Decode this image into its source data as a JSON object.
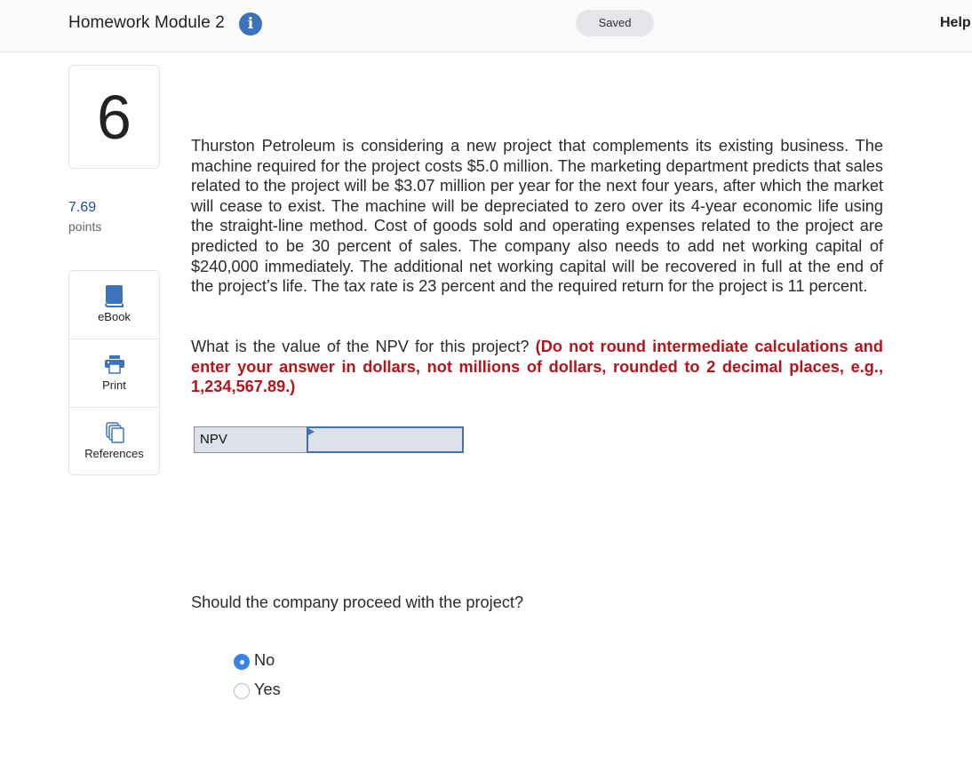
{
  "header": {
    "title": "Homework Module 2",
    "info_icon": "info-icon",
    "saved_label": "Saved",
    "help_label": "Help"
  },
  "question": {
    "number": "6",
    "points_value": "7.69",
    "points_label": "points",
    "body": "Thurston Petroleum is considering a new project that complements its existing business. The machine required for the project costs $5.0 million. The marketing department predicts that sales related to the project will be $3.07 million per year for the next four years, after which the market will cease to exist. The machine will be depreciated to zero over its 4-year economic life using the straight-line method. Cost of goods sold and operating expenses related to the project are predicted to be 30 percent of sales. The company also needs to add net working capital of $240,000 immediately. The additional net working capital will be recovered in full at the end of the project’s life. The tax rate is 23 percent and the required return for the project is 11 percent.",
    "prompt": "What is the value of the NPV for this project?",
    "instruction": "(Do not round intermediate calculations and enter your answer in dollars, not millions of dollars, rounded to 2 decimal places, e.g., 1,234,567.89.)",
    "npv_label": "NPV",
    "npv_value": "",
    "proceed_question": "Should the company proceed with the project?",
    "options": [
      {
        "label": "No",
        "selected": true
      },
      {
        "label": "Yes",
        "selected": false
      }
    ]
  },
  "tools": [
    {
      "label": "eBook",
      "icon": "book-icon"
    },
    {
      "label": "Print",
      "icon": "printer-icon"
    },
    {
      "label": "References",
      "icon": "documents-icon"
    }
  ],
  "colors": {
    "accent_blue": "#3c73bd",
    "instruction_red": "#b5141c",
    "points_blue": "#1d4f91",
    "radio_selected": "#3b82e8"
  }
}
